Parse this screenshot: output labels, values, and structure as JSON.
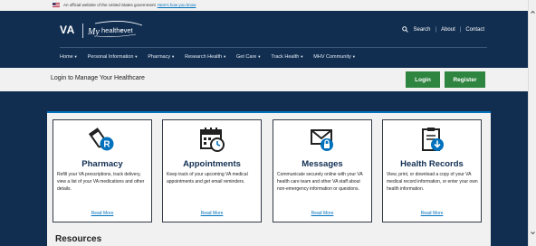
{
  "gov_banner": {
    "text": "An official website of the United States government",
    "link": "Here's how you know"
  },
  "header": {
    "logo_va": "VA",
    "logo_mhv": "My healthevet",
    "utility": {
      "search": "Search",
      "about": "About",
      "contact": "Contact",
      "separator": "|"
    },
    "nav": [
      {
        "label": "Home"
      },
      {
        "label": "Personal Information"
      },
      {
        "label": "Pharmacy"
      },
      {
        "label": "Research Health"
      },
      {
        "label": "Get Care"
      },
      {
        "label": "Track Health"
      },
      {
        "label": "MHV Community"
      }
    ]
  },
  "login_bar": {
    "text": "Login to Manage Your Healthcare",
    "login_label": "Login",
    "register_label": "Register"
  },
  "cards": [
    {
      "icon": "pill-bottle-icon",
      "title": "Pharmacy",
      "description": "Refill your VA prescriptions, track delivery, view a list of your VA medications and other details.",
      "link": "Read More"
    },
    {
      "icon": "calendar-clock-icon",
      "title": "Appointments",
      "description": "Keep track of your upcoming VA medical appointments and get email reminders.",
      "link": "Read More"
    },
    {
      "icon": "envelope-lock-icon",
      "title": "Messages",
      "description": "Communicate securely online with your VA health care team and other VA staff about non-emergency information or questions.",
      "link": "Read More"
    },
    {
      "icon": "clipboard-download-icon",
      "title": "Health Records",
      "description": "View, print, or download a copy of your VA medical record information, or enter your own health information.",
      "link": "Read More"
    }
  ],
  "resources": {
    "heading": "Resources"
  },
  "colors": {
    "navy": "#112e51",
    "blue": "#0071bc",
    "green": "#2e8540",
    "gray": "#f1f1f1"
  }
}
